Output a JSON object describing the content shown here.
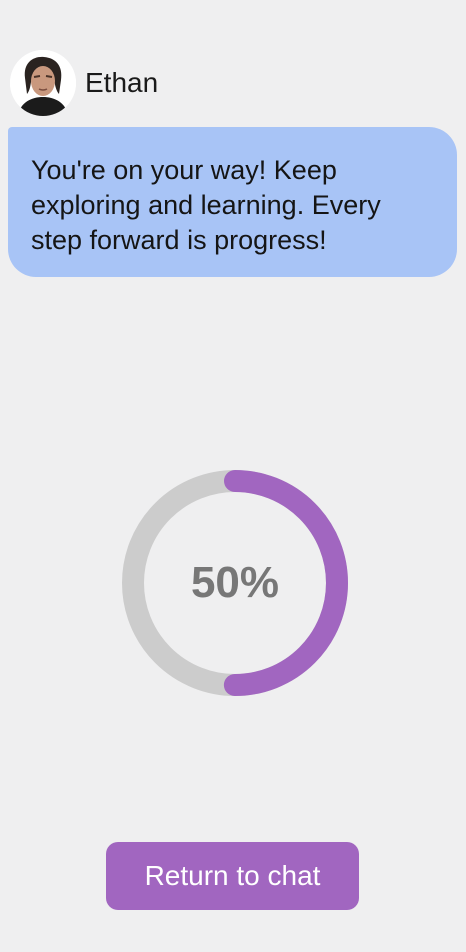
{
  "header": {
    "name": "Ethan",
    "avatar_icon": "user-portrait-icon"
  },
  "message": {
    "text": "You're on your way! Keep exploring and learning. Every step forward is progress!"
  },
  "progress": {
    "label": "50%",
    "value": 0.5,
    "track_color": "#cccccc",
    "fill_color": "#a166c0"
  },
  "actions": {
    "return_label": "Return to chat"
  },
  "colors": {
    "bubble": "#a8c4f6",
    "button": "#a166c0",
    "background": "#efeff0"
  }
}
